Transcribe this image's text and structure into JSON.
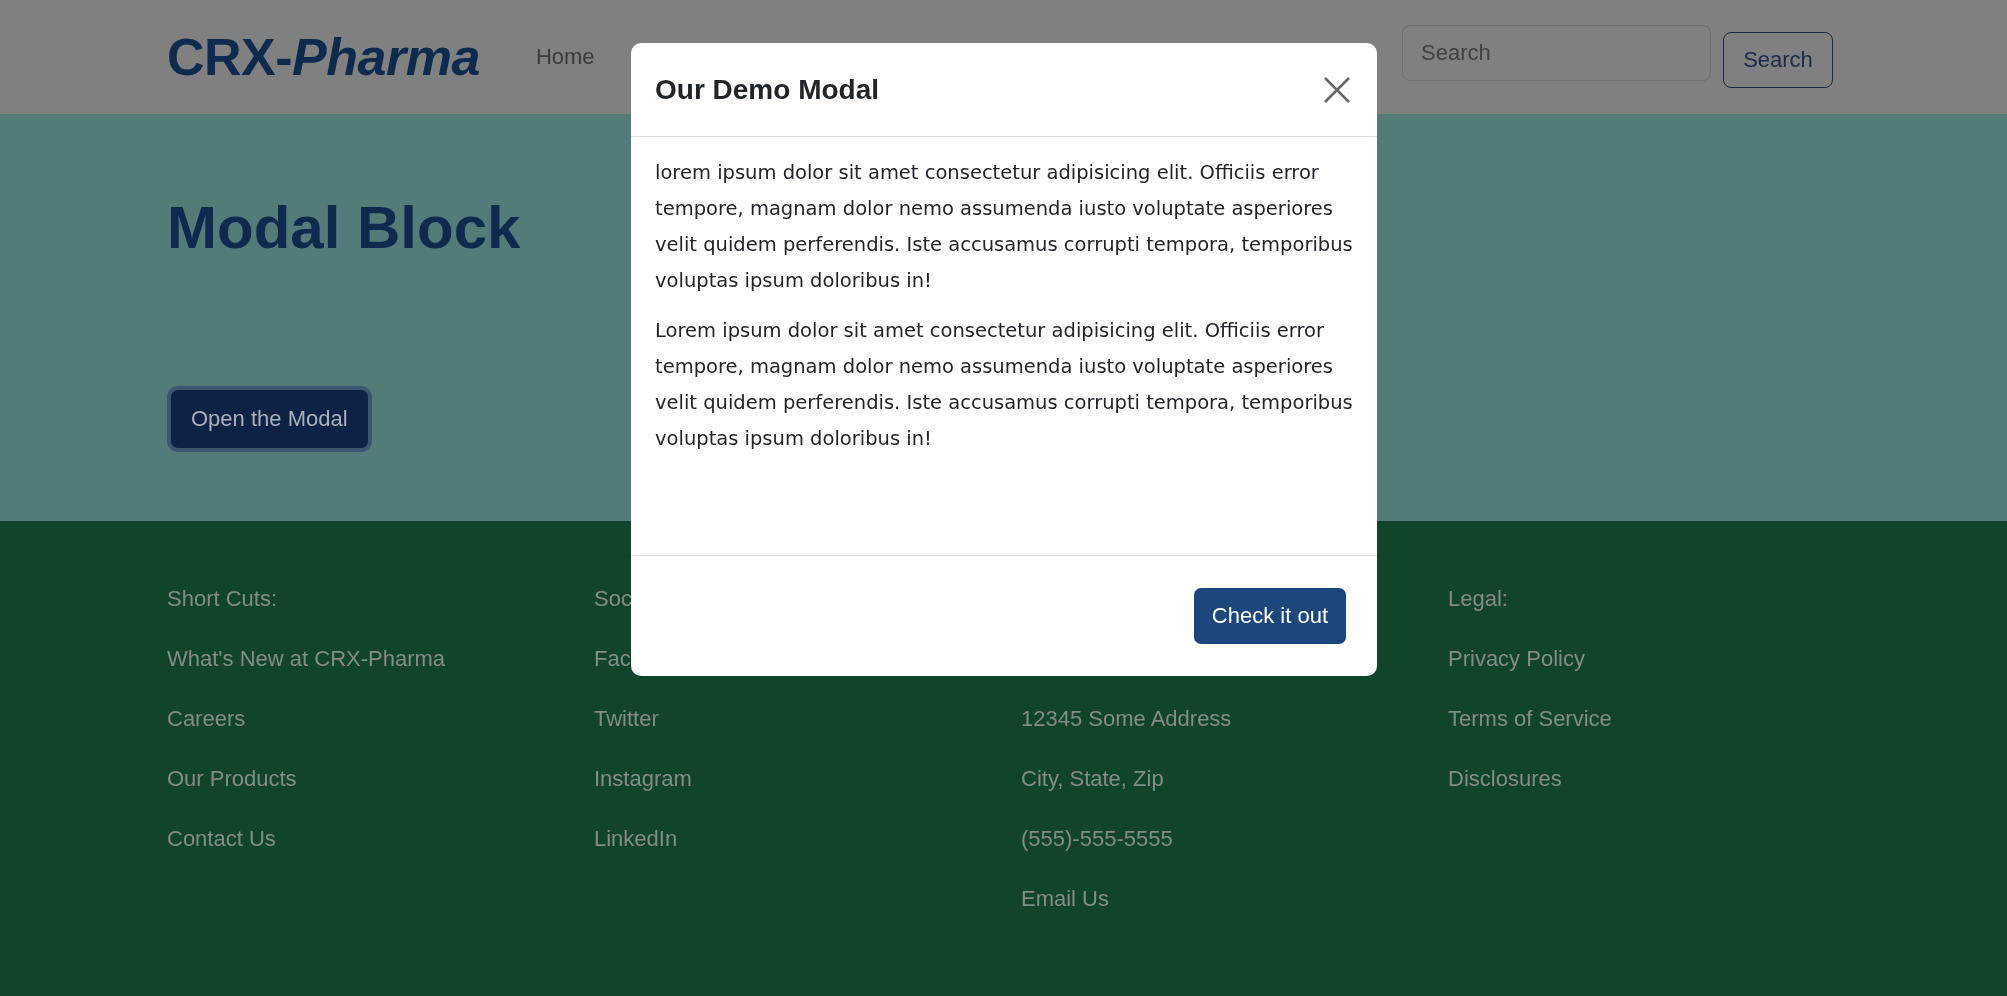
{
  "header": {
    "logo": "CRX-*Pharma*",
    "nav": [
      {
        "label": "Home"
      }
    ],
    "search": {
      "placeholder": "Search"
    },
    "search_button": "Search"
  },
  "hero": {
    "title": "Modal Block",
    "button": "Open the Modal"
  },
  "footer": {
    "columns": [
      {
        "heading": "Short Cuts:",
        "links": [
          "What's New at CRX-Pharma",
          "Careers",
          "Our Products",
          "Contact Us"
        ]
      },
      {
        "heading": "Soc",
        "links": [
          "Fac",
          "Twitter",
          "Instagram",
          "LinkedIn"
        ]
      },
      {
        "links": [
          "12345 Some Address",
          "City, State, Zip",
          "(555)-555-5555",
          "Email Us"
        ]
      },
      {
        "heading": "Legal:",
        "links": [
          "Privacy Policy",
          "Terms of Service",
          "Disclosures"
        ]
      }
    ]
  },
  "modal": {
    "title": "Our Demo Modal",
    "paragraphs": [
      "lorem ipsum dolor sit amet consectetur adipisicing elit. Officiis error tempore, magnam dolor nemo assumenda iusto voluptate asperiores velit quidem perferendis. Iste accusamus corrupti tempora, temporibus voluptas ipsum doloribus in!",
      "Lorem ipsum dolor sit amet consectetur adipisicing elit. Officiis error tempore, magnam dolor nemo assumenda iusto voluptate asperiores velit quidem perferendis. Iste accusamus corrupti tempora, temporibus voluptas ipsum doloribus in!"
    ],
    "button": "Check it out"
  }
}
